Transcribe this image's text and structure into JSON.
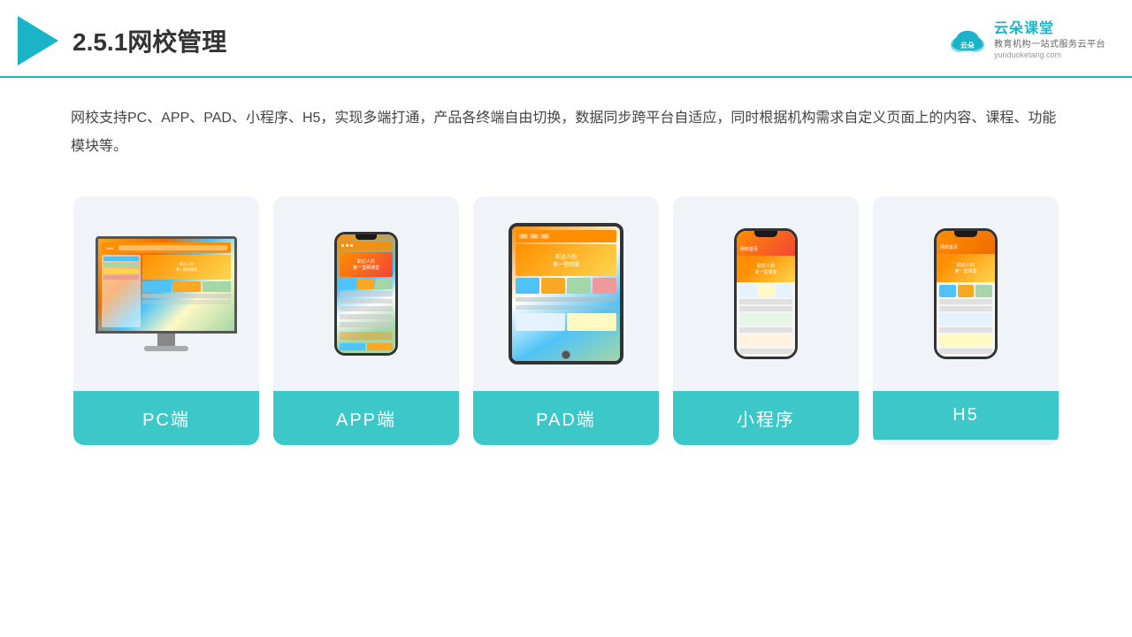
{
  "header": {
    "title": "2.5.1网校管理",
    "brand": {
      "name": "云朵课堂",
      "name_pinyin": "yunduoketang.com",
      "tagline": "教育机构一站",
      "tagline2": "式服务云平台"
    }
  },
  "description": {
    "text": "网校支持PC、APP、PAD、小程序、H5，实现多端打通，产品各终端自由切换，数据同步跨平台自适应，同时根据机构需求自定义页面上的内容、课程、功能模块等。"
  },
  "cards": [
    {
      "id": "pc",
      "label": "PC端"
    },
    {
      "id": "app",
      "label": "APP端"
    },
    {
      "id": "pad",
      "label": "PAD端"
    },
    {
      "id": "miniprogram",
      "label": "小程序"
    },
    {
      "id": "h5",
      "label": "H5"
    }
  ],
  "colors": {
    "accent": "#1ab3c8",
    "card_bg": "#eef2f7",
    "card_label_bg": "#3cc8c8",
    "title_color": "#333333"
  }
}
